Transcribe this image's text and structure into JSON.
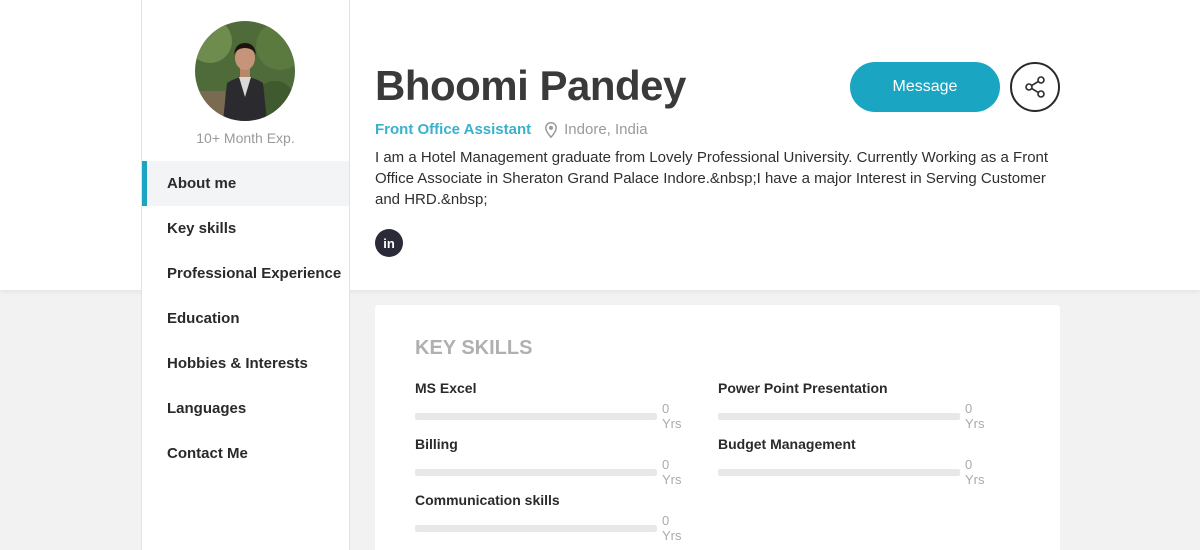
{
  "profile": {
    "name": "Bhoomi Pandey",
    "role": "Front Office Assistant",
    "location": "Indore, India",
    "experience": "10+ Month Exp.",
    "bio": "I am a Hotel Management graduate from Lovely Professional University. Currently Working as a Front Office Associate in Sheraton Grand Palace Indore.&nbsp;I have a major Interest in Serving Customer and HRD.&nbsp;",
    "social": {
      "linkedin_label": "in"
    }
  },
  "actions": {
    "message_label": "Message",
    "share_icon": "share-icon"
  },
  "sidebar": {
    "items": [
      {
        "label": "About me",
        "active": true
      },
      {
        "label": "Key skills",
        "active": false
      },
      {
        "label": "Professional Experience",
        "active": false
      },
      {
        "label": "Education",
        "active": false
      },
      {
        "label": "Hobbies & Interests",
        "active": false
      },
      {
        "label": "Languages",
        "active": false
      },
      {
        "label": "Contact Me",
        "active": false
      }
    ]
  },
  "key_skills": {
    "title": "KEY SKILLS",
    "skills": [
      {
        "name": "MS Excel",
        "years": "0 Yrs",
        "level": 0
      },
      {
        "name": "Power Point Presentation",
        "years": "0 Yrs",
        "level": 0
      },
      {
        "name": "Billing",
        "years": "0 Yrs",
        "level": 0
      },
      {
        "name": "Budget Management",
        "years": "0 Yrs",
        "level": 0
      },
      {
        "name": "Communication skills",
        "years": "0 Yrs",
        "level": 0
      }
    ]
  },
  "colors": {
    "accent": "#1aa5c2",
    "role_text": "#39b1cb",
    "muted": "#9a9a9a"
  }
}
